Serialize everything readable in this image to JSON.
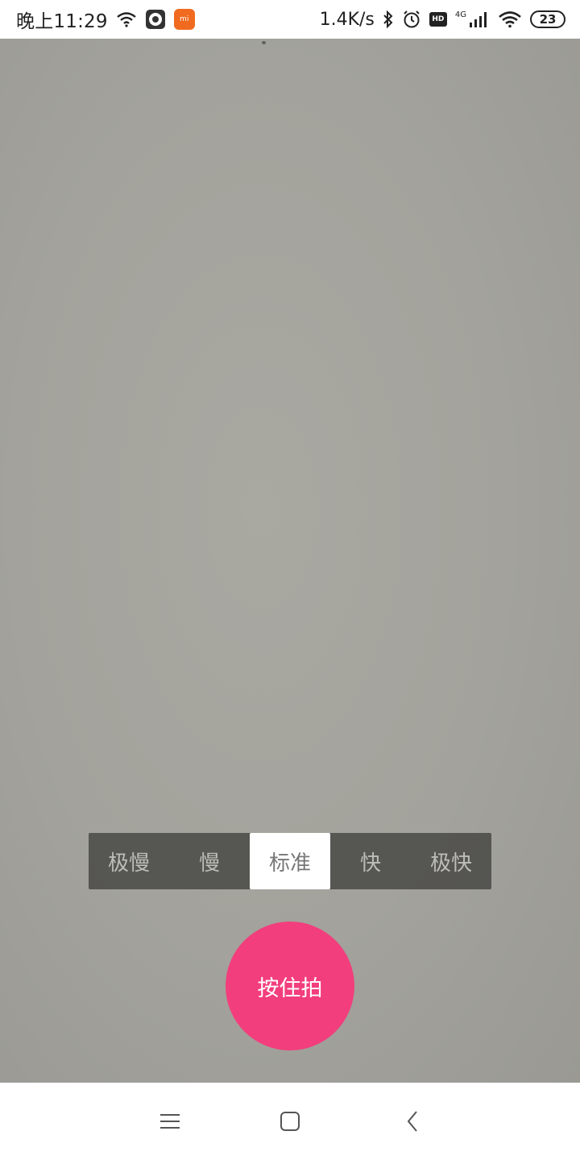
{
  "status_bar": {
    "time": "晚上11:29",
    "net_speed": "1.4K/s",
    "network_type": "4G",
    "hd_label": "HD",
    "battery_level": "23",
    "icons": [
      "wifi-icon",
      "vinyl-icon",
      "mi-app-icon",
      "bluetooth-icon",
      "alarm-icon",
      "hd-icon",
      "signal-4g-icon",
      "wifi-icon",
      "battery-icon"
    ]
  },
  "app_badge": "mi",
  "speed_selector": {
    "options": [
      "极慢",
      "慢",
      "标准",
      "快",
      "极快"
    ],
    "selected": "标准"
  },
  "shutter": {
    "label": "按住拍",
    "color": "#f23e7c"
  },
  "nav_bar": {
    "icons": [
      "menu-icon",
      "home-icon",
      "back-icon"
    ]
  },
  "colors": {
    "viewfinder": "#a4a39d",
    "speed_bar_bg": "#4a4a47",
    "selected_bg": "#ffffff"
  }
}
